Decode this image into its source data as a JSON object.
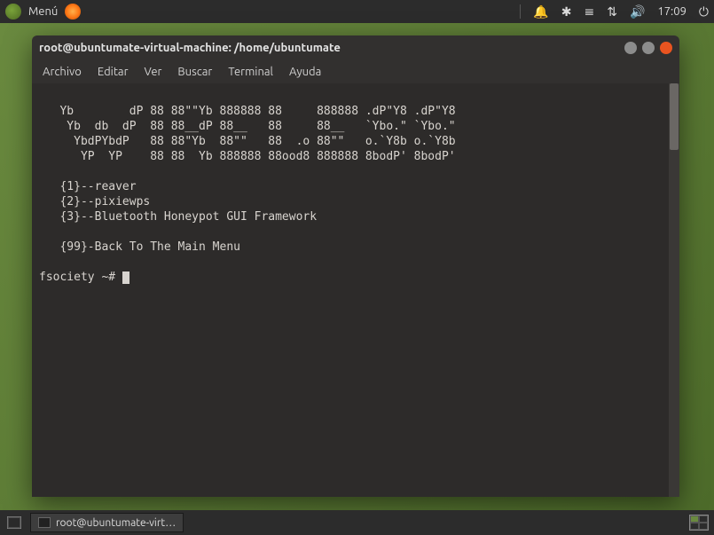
{
  "topbar": {
    "menu_label": "Menú",
    "clock": "17:09"
  },
  "window": {
    "title": "root@ubuntumate-virtual-machine: /home/ubuntumate"
  },
  "menubar": {
    "archivo": "Archivo",
    "editar": "Editar",
    "ver": "Ver",
    "buscar": "Buscar",
    "terminal": "Terminal",
    "ayuda": "Ayuda"
  },
  "terminal": {
    "ascii1": "   Yb        dP 88 88\"\"Yb 888888 88     888888 .dP\"Y8 .dP\"Y8",
    "ascii2": "    Yb  db  dP  88 88__dP 88__   88     88__   `Ybo.\" `Ybo.\"",
    "ascii3": "     YbdPYbdP   88 88\"Yb  88\"\"   88  .o 88\"\"   o.`Y8b o.`Y8b",
    "ascii4": "      YP  YP    88 88  Yb 888888 88ood8 888888 8bodP' 8bodP'",
    "opt1": "   {1}--reaver",
    "opt2": "   {2}--pixiewps",
    "opt3": "   {3}--Bluetooth Honeypot GUI Framework",
    "opt99": "   {99}-Back To The Main Menu",
    "prompt": "fsociety ~# "
  },
  "taskbar": {
    "item": "root@ubuntumate-virt…"
  }
}
